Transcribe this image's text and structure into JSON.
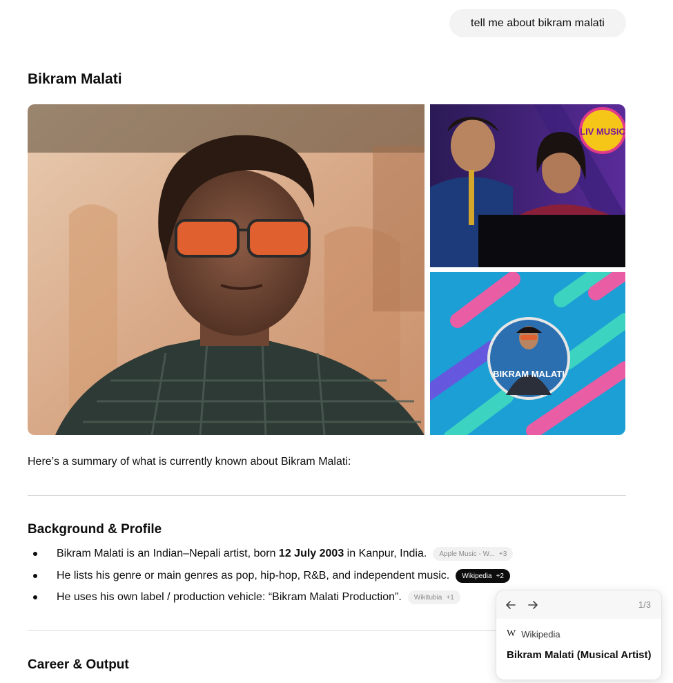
{
  "user_message": "tell me about bikram malati",
  "entity": {
    "title": "Bikram Malati",
    "images": [
      {
        "name": "portrait-photo"
      },
      {
        "name": "performance-photo",
        "badge_text": "LIV MUSIC"
      },
      {
        "name": "album-art-photo",
        "art_text": "BIKRAM MALATI"
      }
    ]
  },
  "summary": "Here’s a summary of what is currently known about Bikram Malati:",
  "sections": [
    {
      "title": "Background & Profile",
      "bullets": [
        {
          "before": "Bikram Malati is an Indian–Nepali artist, born ",
          "bold": "12 July 2003",
          "after": " in Kanpur, India.",
          "citation": {
            "label": "Apple Music - W...",
            "more": "+3",
            "active": false
          }
        },
        {
          "text": "He lists his genre or main genres as pop, hip-hop, R&B, and independent music.",
          "citation": {
            "label": "Wikipedia",
            "more": "+2",
            "active": true
          }
        },
        {
          "text": "He uses his own label / production vehicle: “Bikram Malati Production”.",
          "citation": {
            "label": "Wikitubia",
            "more": "+1",
            "active": false
          }
        }
      ]
    },
    {
      "title": "Career & Output"
    }
  ],
  "citation_popover": {
    "counter": "1/3",
    "source_icon": "W",
    "source_name": "Wikipedia",
    "title": "Bikram Malati (Musical Artist)"
  },
  "colors": {
    "user_bubble": "#f3f3f3",
    "active_pill": "#0d0d0d",
    "pill": "#f1f1f1"
  }
}
